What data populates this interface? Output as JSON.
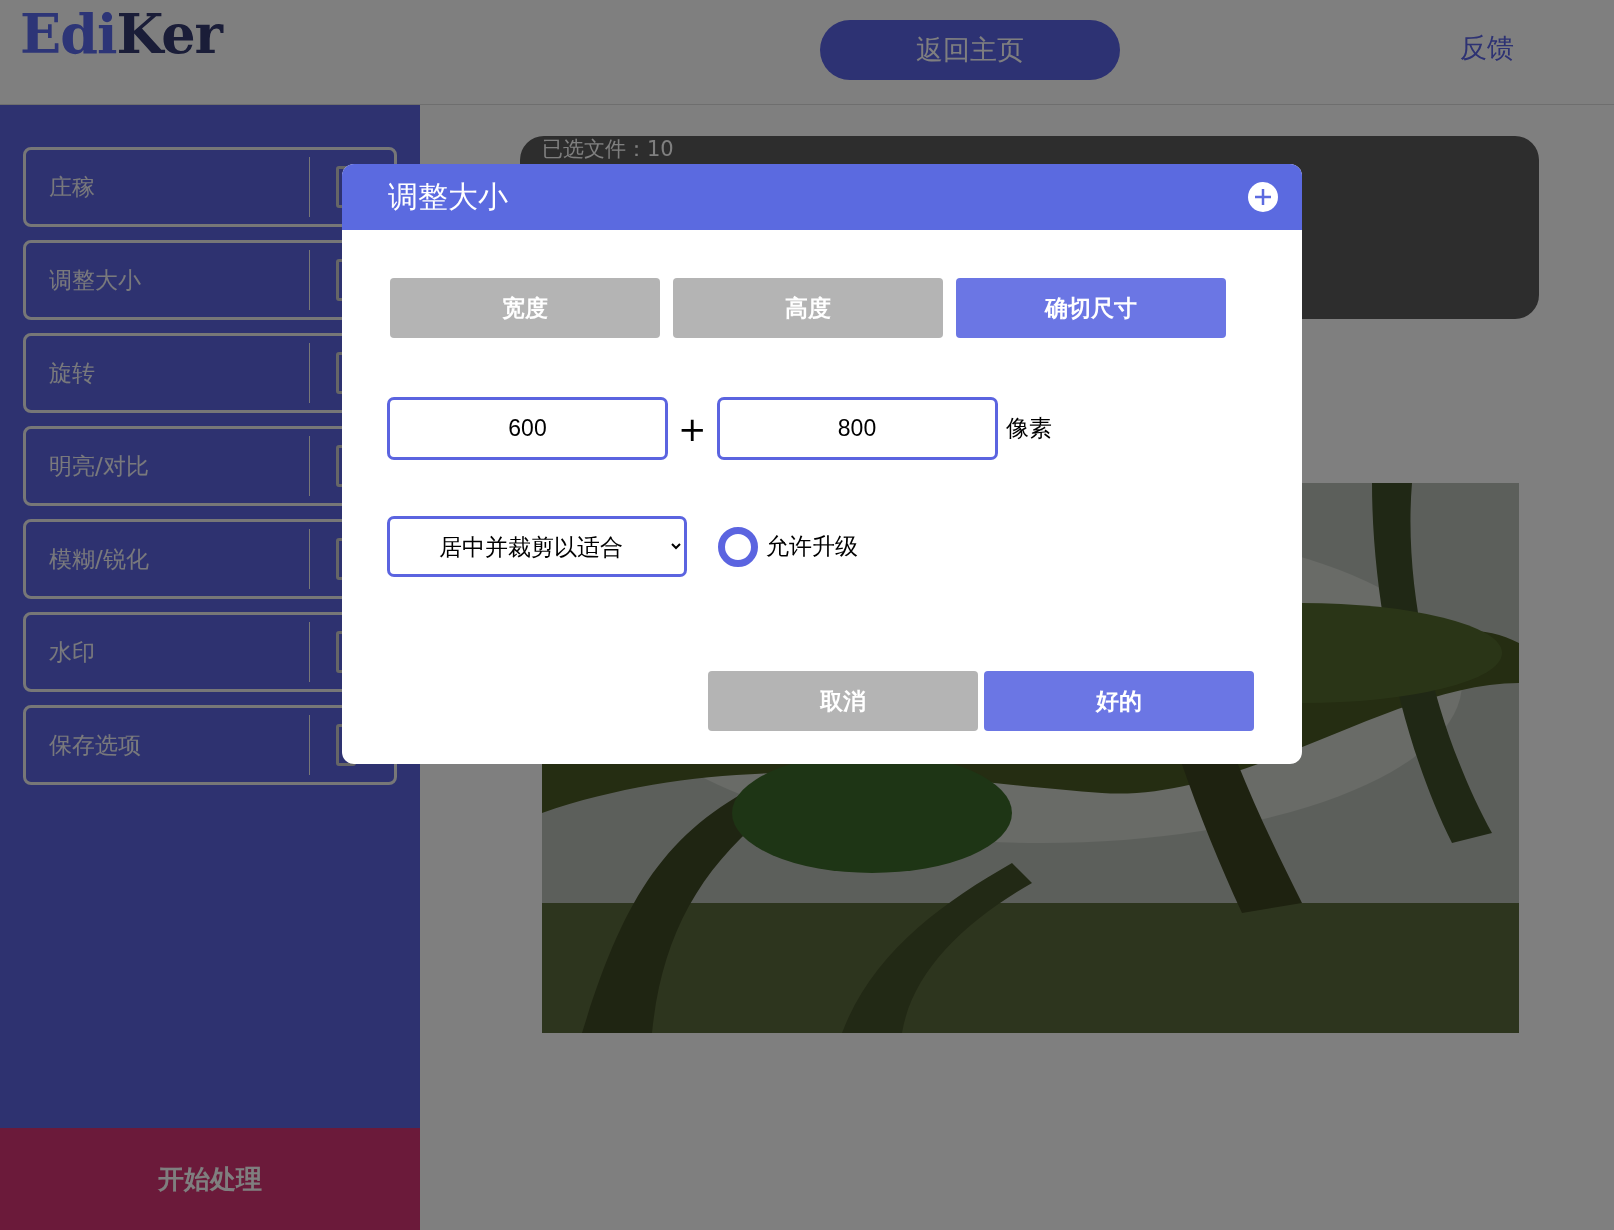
{
  "header": {
    "logo": {
      "part_1": "Edi",
      "part_2": "Ker"
    },
    "home_button": "返回主页",
    "feedback_link": "反馈"
  },
  "sidebar": {
    "items": [
      {
        "label": "庄稼"
      },
      {
        "label": "调整大小"
      },
      {
        "label": "旋转"
      },
      {
        "label": "明亮/对比"
      },
      {
        "label": "模糊/锐化"
      },
      {
        "label": "水印"
      },
      {
        "label": "保存选项"
      }
    ],
    "start_button": "开始处理"
  },
  "main": {
    "file_count": "已选文件：10"
  },
  "dialog": {
    "title": "调整大小",
    "tabs": [
      {
        "label": "宽度",
        "selected": false
      },
      {
        "label": "高度",
        "selected": false
      },
      {
        "label": "确切尺寸",
        "selected": true
      }
    ],
    "width_value": "600",
    "separator": "+",
    "height_value": "800",
    "unit": "像素",
    "fit_select": "居中并裁剪以适合",
    "upscale": {
      "label": "允许升级",
      "checked": false
    },
    "buttons": [
      {
        "label": "取消",
        "kind": "secondary"
      },
      {
        "label": "好的",
        "kind": "primary"
      }
    ]
  }
}
